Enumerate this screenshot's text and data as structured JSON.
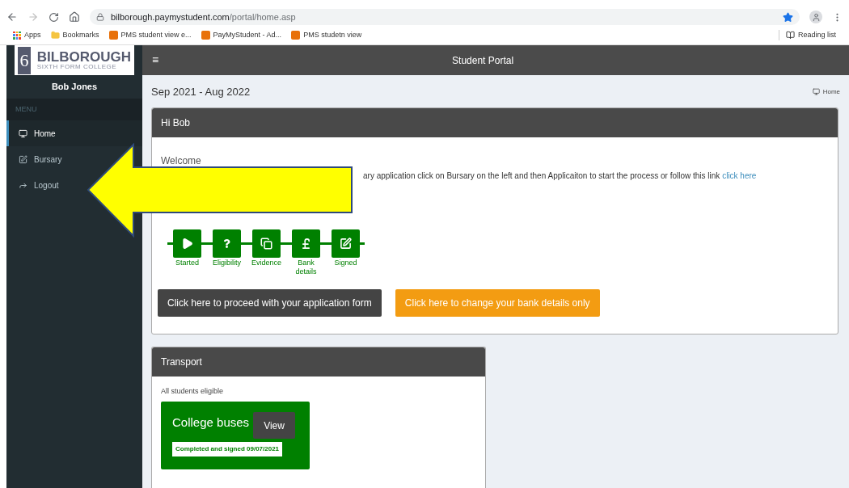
{
  "browser": {
    "url_host": "bilborough.paymystudent.com",
    "url_path": "/portal/home.asp",
    "bookmarks": [
      "Apps",
      "Bookmarks",
      "PMS student view e...",
      "PayMyStudent - Ad...",
      "PMS studetn view"
    ],
    "reading_list": "Reading list"
  },
  "logo": {
    "mark": "6",
    "name": "BILBOROUGH",
    "subtitle": "SIXTH FORM COLLEGE"
  },
  "topbar": {
    "menu_glyph": "≡",
    "title": "Student Portal"
  },
  "sidebar": {
    "user": "Bob Jones",
    "section": "MENU",
    "items": [
      {
        "label": "Home",
        "selected": true
      },
      {
        "label": "Bursary",
        "selected": false
      },
      {
        "label": "Logout",
        "selected": false
      }
    ]
  },
  "page": {
    "period": "Sep 2021 - Aug 2022",
    "breadcrumb": "Home"
  },
  "welcome_panel": {
    "title": "Hi Bob",
    "heading": "Welcome",
    "text": "ary application click on Bursary on the left and then Applicaiton to start the process or follow this link",
    "link": "click here",
    "steps": [
      {
        "label": "Started",
        "done": true
      },
      {
        "label": "Eligibility",
        "done": true
      },
      {
        "label": "Evidence",
        "done": true
      },
      {
        "label": "Bank details",
        "done": true
      },
      {
        "label": "Signed",
        "done": true
      }
    ],
    "primary_button": "Click here to proceed with your application form",
    "secondary_button": "Click here to change your bank details only"
  },
  "transport_panel": {
    "title": "Transport",
    "note": "All students eligible",
    "tile": {
      "title": "College buses",
      "button": "View",
      "status": "Completed and signed 09/07/2021"
    }
  }
}
